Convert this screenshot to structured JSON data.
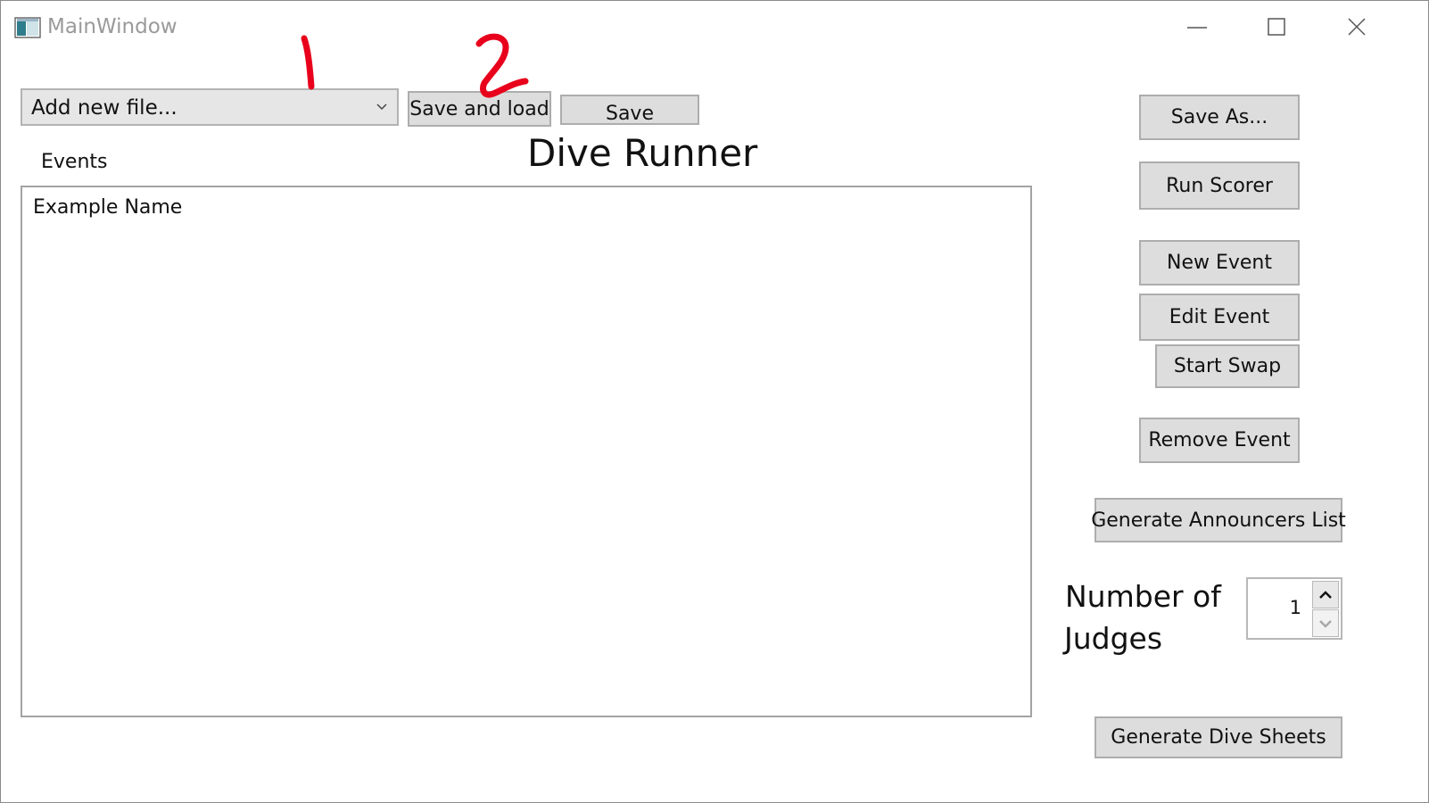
{
  "window": {
    "title": "MainWindow"
  },
  "toolbar": {
    "file_combo_value": "Add new file...",
    "save_and_load_label": "Save and load",
    "save_label": "Save"
  },
  "main": {
    "heading": "Dive Runner",
    "events_label": "Events",
    "events": [
      "Example Name"
    ]
  },
  "side": {
    "save_as_label": "Save As...",
    "run_scorer_label": "Run Scorer",
    "new_event_label": "New Event",
    "edit_event_label": "Edit Event",
    "start_swap_label": "Start Swap",
    "remove_event_label": "Remove Event",
    "generate_announcers_label": "Generate Announcers List",
    "judges_label_line1": "Number of",
    "judges_label_line2": "Judges",
    "judges_value": "1",
    "generate_dive_sheets_label": "Generate Dive Sheets"
  },
  "annotations": {
    "marker_1": "1",
    "marker_2": "2",
    "color": "#e8001c"
  },
  "colors": {
    "button_bg": "#dddddd",
    "button_border": "#adadad",
    "title_text": "#9a9a9a"
  },
  "icons": [
    "app-icon",
    "minimize-icon",
    "maximize-icon",
    "close-icon",
    "chevron-down-icon",
    "spin-up-icon",
    "spin-down-icon"
  ]
}
